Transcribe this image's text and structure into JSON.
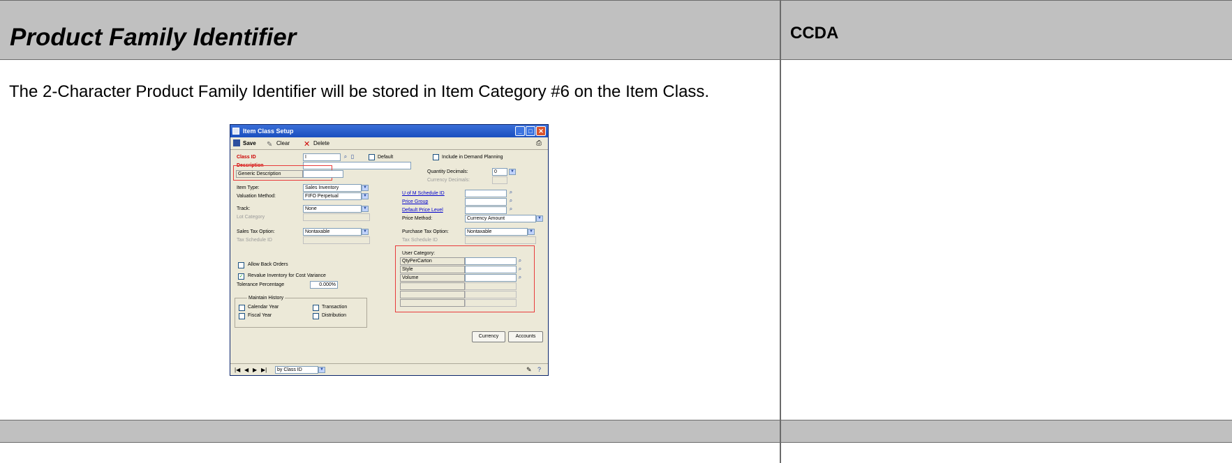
{
  "header": {
    "title": "Product Family Identifier",
    "side_title": "CCDA"
  },
  "body": {
    "paragraph": "The 2-Character Product Family Identifier will be stored in Item Category #6 on the Item Class."
  },
  "window": {
    "title": "Item Class Setup",
    "toolbar": {
      "save": "Save",
      "clear": "Clear",
      "delete": "Delete"
    },
    "class_id_label": "Class ID",
    "class_id_value": "I",
    "default_label": "Default",
    "include_demand_label": "Include in Demand Planning",
    "description_label": "Description",
    "generic_description_label": "Generic Description",
    "quantity_decimals_label": "Quantity Decimals:",
    "quantity_decimals_value": "0",
    "currency_decimals_label": "Currency Decimals:",
    "item_type_label": "Item Type:",
    "item_type_value": "Sales Inventory",
    "valuation_label": "Valuation Method:",
    "valuation_value": "FIFO Perpetual",
    "track_label": "Track:",
    "track_value": "None",
    "lot_category_label": "Lot Category",
    "uofm_label": "U of M Schedule ID",
    "price_group_label": "Price Group",
    "default_price_level_label": "Default Price Level",
    "price_method_label": "Price Method:",
    "price_method_value": "Currency Amount",
    "sales_tax_label": "Sales Tax Option:",
    "sales_tax_value": "Nontaxable",
    "tax_schedule_label": "Tax Schedule ID",
    "purchase_tax_label": "Purchase Tax Option:",
    "purchase_tax_value": "Nontaxable",
    "purchase_tax_schedule_label": "Tax Schedule ID",
    "allow_back_orders_label": "Allow Back Orders",
    "revalue_label": "Revalue Inventory for Cost Variance",
    "tolerance_label": "Tolerance Percentage",
    "tolerance_value": "0.000%",
    "maintain_history_label": "Maintain History",
    "calendar_year_label": "Calendar Year",
    "transaction_label": "Transaction",
    "fiscal_year_label": "Fiscal Year",
    "distribution_label": "Distribution",
    "user_category_label": "User Category:",
    "user_categories": [
      "QtyPerCarton",
      "Style",
      "Volume",
      "",
      "",
      ""
    ],
    "currency_button": "Currency",
    "accounts_button": "Accounts",
    "sort_value": "by Class ID"
  }
}
